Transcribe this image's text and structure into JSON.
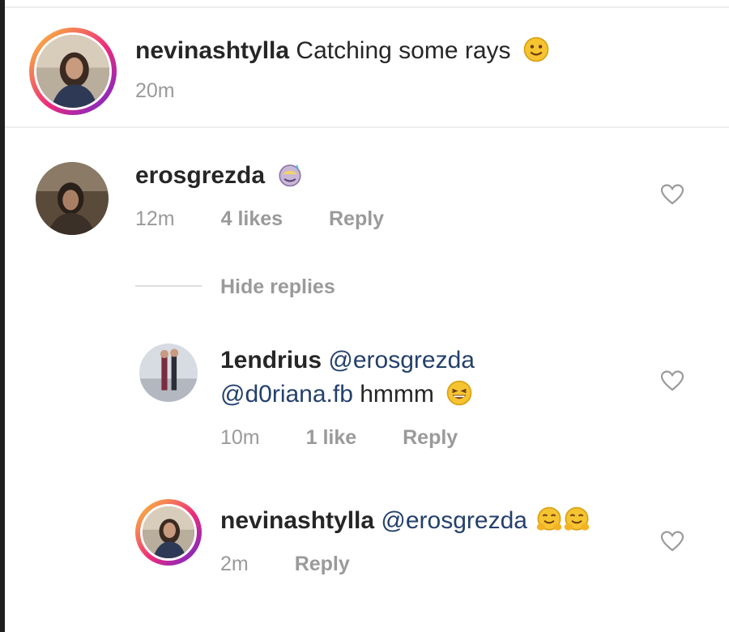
{
  "caption": {
    "username": "nevinashtylla",
    "text": "Catching some rays",
    "emoji": "slightly-smiling-face",
    "time": "20m"
  },
  "comments": [
    {
      "username": "erosgrezda",
      "text": "",
      "emoji": "sweat-smile-face",
      "time": "12m",
      "likes": "4 likes",
      "reply_label": "Reply"
    }
  ],
  "hide_replies_label": "Hide replies",
  "replies": [
    {
      "username": "1endrius",
      "mention1": "@erosgrezda",
      "mention2": "@d0riana.fb",
      "text": "hmmm",
      "emoji": "grinning-squinting-face",
      "time": "10m",
      "likes": "1 like",
      "reply_label": "Reply"
    },
    {
      "username": "nevinashtylla",
      "mention1": "@erosgrezda",
      "emoji": "hugging-face",
      "emoji_count": 2,
      "time": "2m",
      "reply_label": "Reply"
    }
  ],
  "colors": {
    "mention": "#24406d",
    "meta_gray": "#9a9a9a",
    "story_ring": "#ee2a7b"
  },
  "icons": {
    "like": "heart-outline-icon"
  }
}
